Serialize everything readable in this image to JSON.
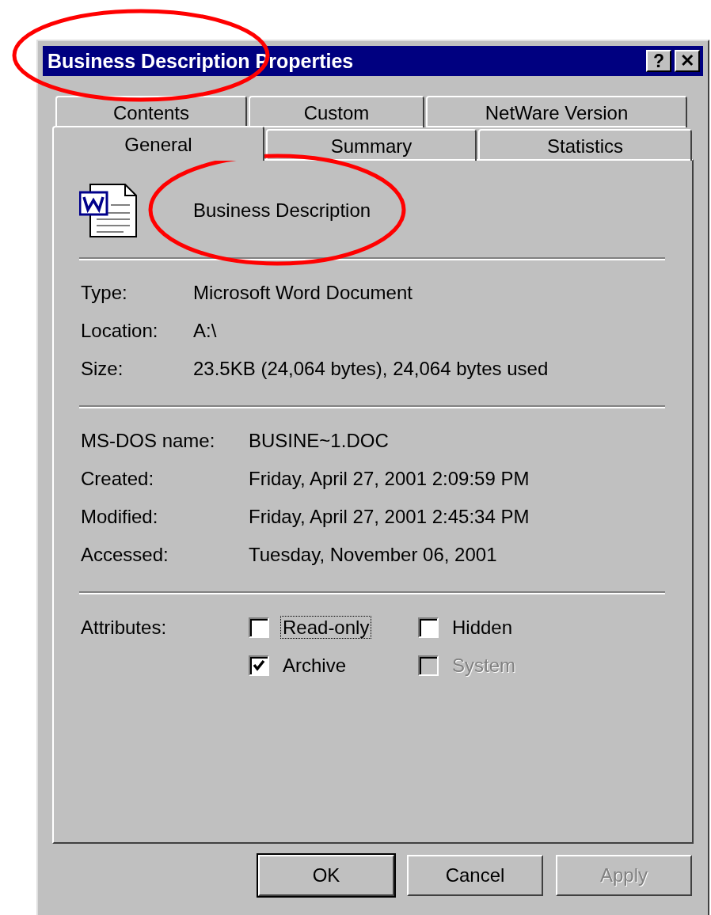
{
  "window": {
    "title": "Business Description Properties",
    "buttons": [
      {
        "kind": "help",
        "label": "?"
      },
      {
        "kind": "close",
        "label": "✕"
      }
    ]
  },
  "tab_rows": [
    [
      {
        "label": "Contents",
        "selected": false
      },
      {
        "label": "Custom",
        "selected": false
      },
      {
        "label": "NetWare Version",
        "selected": false
      }
    ],
    [
      {
        "label": "General",
        "selected": true
      },
      {
        "label": "Summary",
        "selected": false
      },
      {
        "label": "Statistics",
        "selected": false
      }
    ]
  ],
  "file": {
    "name": "Business Description"
  },
  "sections": [
    [
      {
        "label": "Type:",
        "value": "Microsoft Word Document"
      },
      {
        "label": "Location:",
        "value": "A:\\"
      },
      {
        "label": "Size:",
        "value": "23.5KB (24,064 bytes), 24,064 bytes used"
      }
    ],
    [
      {
        "label": "MS-DOS name:",
        "value": "BUSINE~1.DOC"
      },
      {
        "label": "Created:",
        "value": "Friday, April 27, 2001 2:09:59 PM"
      },
      {
        "label": "Modified:",
        "value": "Friday, April 27, 2001 2:45:34 PM"
      },
      {
        "label": "Accessed:",
        "value": "Tuesday, November 06, 2001"
      }
    ]
  ],
  "attributes": {
    "label": "Attributes:",
    "items": [
      {
        "label": "Read-only",
        "checked": false,
        "disabled": false,
        "focused": true
      },
      {
        "label": "Hidden",
        "checked": false,
        "disabled": false,
        "focused": false
      },
      {
        "label": "Archive",
        "checked": true,
        "disabled": false,
        "focused": false
      },
      {
        "label": "System",
        "checked": false,
        "disabled": true,
        "focused": false
      }
    ]
  },
  "buttons": [
    {
      "label": "OK",
      "default": true,
      "disabled": false
    },
    {
      "label": "Cancel",
      "default": false,
      "disabled": false
    },
    {
      "label": "Apply",
      "default": false,
      "disabled": true
    }
  ],
  "annotations": [
    {
      "kind": "ellipse",
      "color": "#ff0000"
    },
    {
      "kind": "ellipse",
      "color": "#ff0000"
    }
  ]
}
